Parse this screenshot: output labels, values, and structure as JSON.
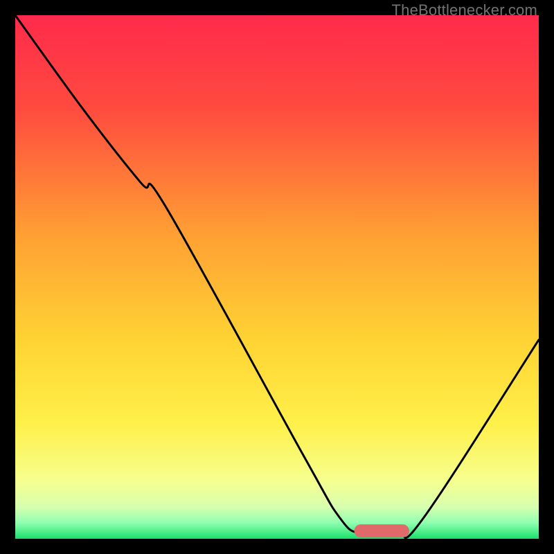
{
  "watermark": {
    "text": "TheBottlenecker.com"
  },
  "chart_data": {
    "type": "line",
    "title": "",
    "xlabel": "",
    "ylabel": "",
    "xlim": [
      0,
      100
    ],
    "ylim": [
      0,
      100
    ],
    "gradient_stops": [
      {
        "offset": 0,
        "color": "#ff2a4b"
      },
      {
        "offset": 18,
        "color": "#ff4b3f"
      },
      {
        "offset": 42,
        "color": "#ffa033"
      },
      {
        "offset": 62,
        "color": "#ffd333"
      },
      {
        "offset": 78,
        "color": "#fff04a"
      },
      {
        "offset": 89,
        "color": "#f6ff8f"
      },
      {
        "offset": 94,
        "color": "#d6ffb0"
      },
      {
        "offset": 97,
        "color": "#8fffb0"
      },
      {
        "offset": 100,
        "color": "#18e06a"
      }
    ],
    "curve": [
      {
        "x": 0,
        "y": 100
      },
      {
        "x": 13,
        "y": 82
      },
      {
        "x": 24,
        "y": 68
      },
      {
        "x": 29,
        "y": 63
      },
      {
        "x": 55,
        "y": 16
      },
      {
        "x": 62,
        "y": 4
      },
      {
        "x": 66,
        "y": 1
      },
      {
        "x": 73,
        "y": 1
      },
      {
        "x": 78,
        "y": 4
      },
      {
        "x": 100,
        "y": 38
      }
    ],
    "marker": {
      "x_start": 66,
      "x_end": 74,
      "y": 1.5,
      "color": "#e06a6a",
      "thickness": 2.5
    }
  }
}
